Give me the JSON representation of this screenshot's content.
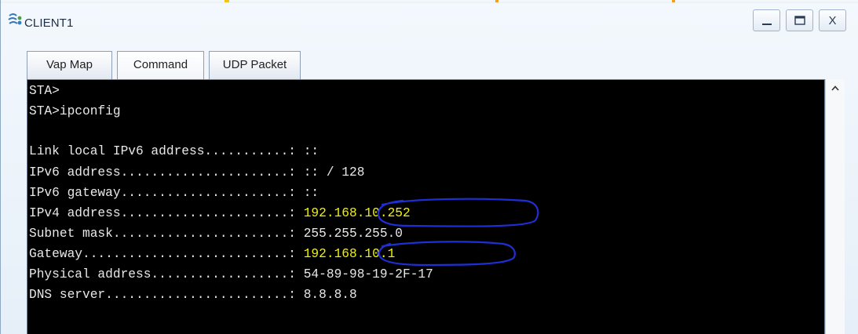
{
  "window": {
    "title": "CLIENT1",
    "app_icon": "network-client-icon",
    "controls": {
      "minimize_icon": "minimize-icon",
      "maximize_icon": "maximize-icon",
      "close_label": "X"
    }
  },
  "tabs": [
    {
      "label": "Vap Map",
      "active": false
    },
    {
      "label": "Command",
      "active": true
    },
    {
      "label": "UDP Packet",
      "active": false
    }
  ],
  "console": {
    "lines": [
      {
        "text": "STA>"
      },
      {
        "text": "STA>ipconfig"
      },
      {
        "text": ""
      },
      {
        "label": "Link local IPv6 address...........: ",
        "value": "::"
      },
      {
        "label": "IPv6 address......................: ",
        "value": ":: / 128"
      },
      {
        "label": "IPv6 gateway......................: ",
        "value": "::"
      },
      {
        "label": "IPv4 address......................: ",
        "value": "192.168.10.252",
        "highlight": true
      },
      {
        "label": "Subnet mask.......................: ",
        "value": "255.255.255.0"
      },
      {
        "label": "Gateway...........................: ",
        "value": "192.168.10.1",
        "highlight": true
      },
      {
        "label": "Physical address..................: ",
        "value": "54-89-98-19-2F-17"
      },
      {
        "label": "DNS server........................: ",
        "value": "8.8.8.8"
      }
    ]
  },
  "colors": {
    "console_bg": "#000000",
    "console_text": "#e8e8e8",
    "highlight_text": "#f2f200",
    "annotation_ink": "#1e2fd6"
  },
  "scrollbar": {
    "up_icon": "scroll-up-arrow-icon"
  }
}
